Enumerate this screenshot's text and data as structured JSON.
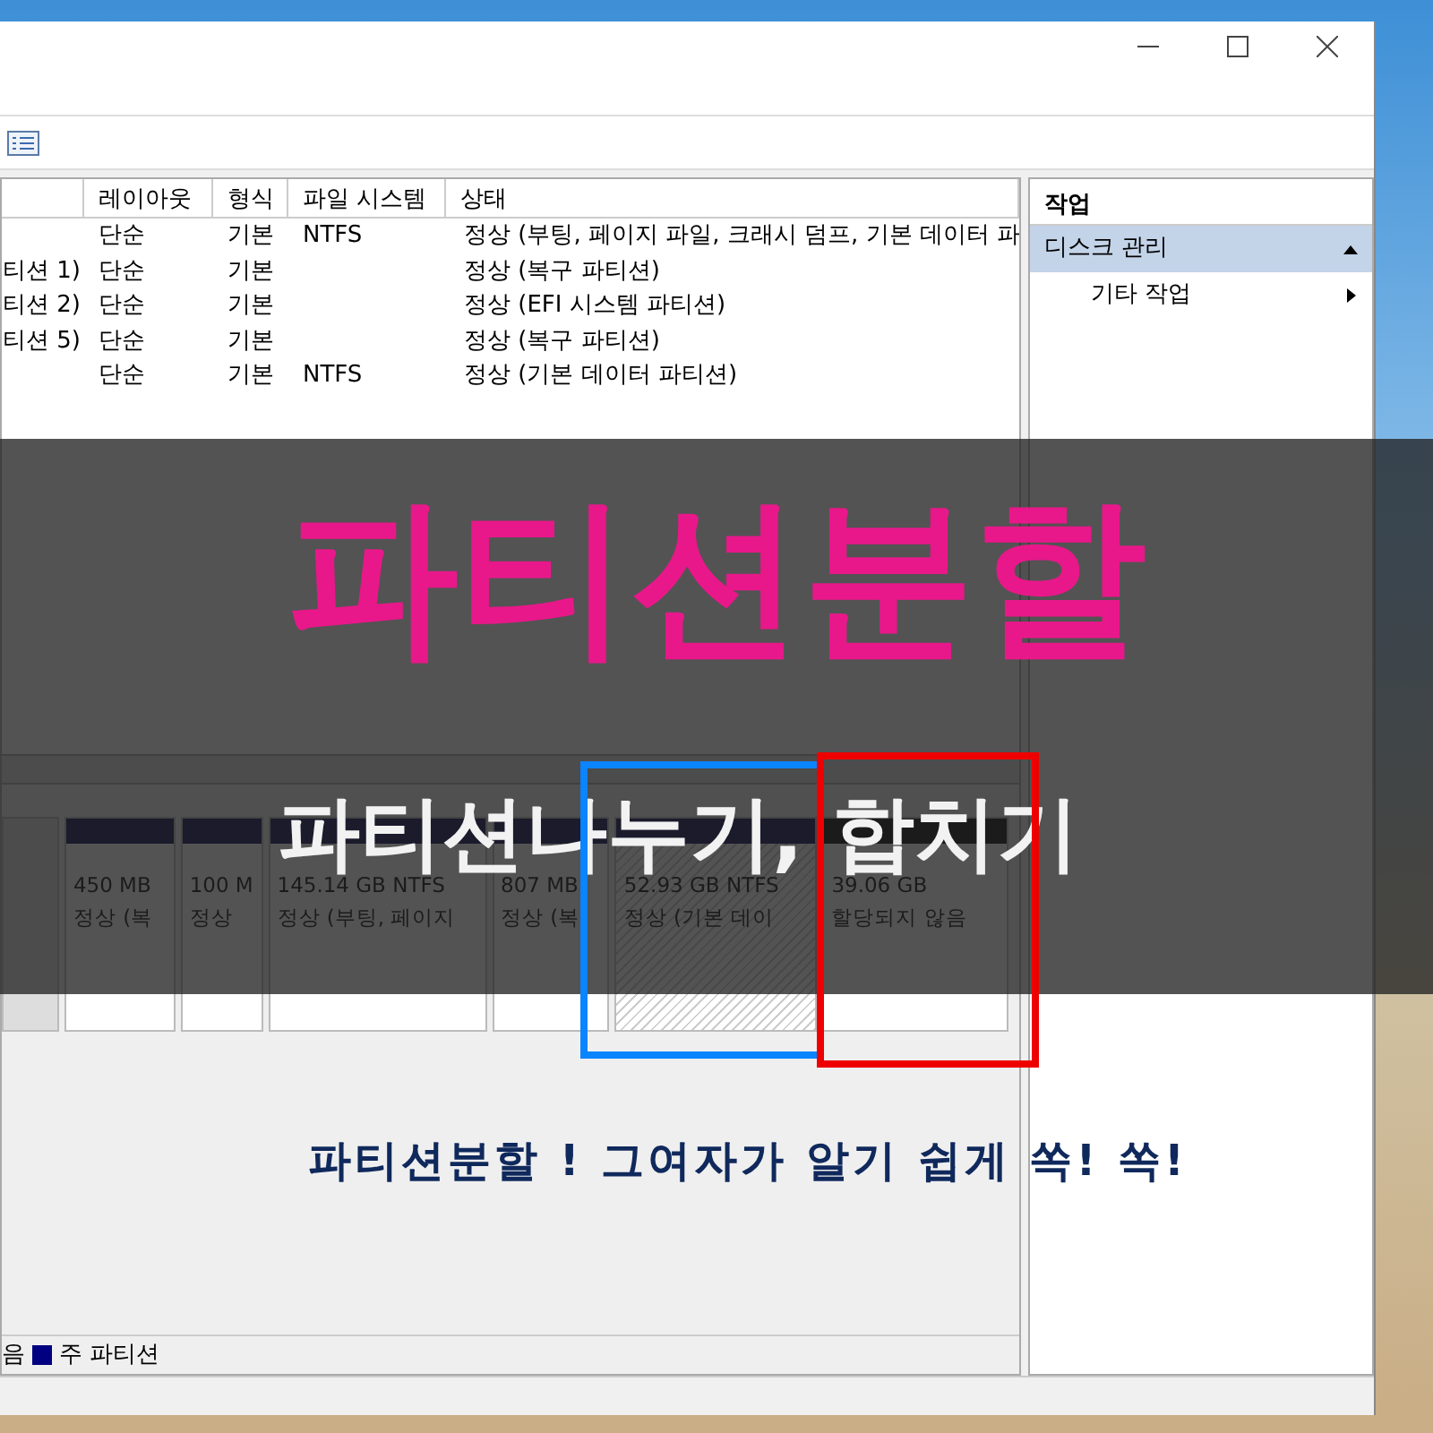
{
  "volume_list": {
    "columns": [
      "레이아웃",
      "형식",
      "파일 시스템",
      "상태"
    ],
    "rows": [
      {
        "layout": "단순",
        "type": "기본",
        "file_system": "NTFS",
        "status": "정상 (부팅, 페이지 파일, 크래시 덤프, 기본 데이터 파"
      },
      {
        "name": "티션 1)",
        "layout": "단순",
        "type": "기본",
        "status": "정상 (복구 파티션)"
      },
      {
        "name": "티션 2)",
        "layout": "단순",
        "type": "기본",
        "status": "정상 (EFI 시스템 파티션)"
      },
      {
        "name": "티션 5)",
        "layout": "단순",
        "type": "기본",
        "status": "정상 (복구 파티션)"
      },
      {
        "layout": "단순",
        "type": "기본",
        "file_system": "NTFS",
        "status": "정상 (기본 데이터 파티션)"
      }
    ]
  },
  "disk_map": {
    "partitions": [
      {
        "size": "450 MB",
        "status": "정상 (복",
        "kind": "primary",
        "selected": false
      },
      {
        "size": "100 M",
        "status": "정상",
        "kind": "primary",
        "selected": false
      },
      {
        "size": "145.14 GB NTFS",
        "status": "정상 (부팅, 페이지",
        "kind": "primary",
        "selected": false
      },
      {
        "size": "807 MB",
        "status": "정상 (복",
        "kind": "primary",
        "selected": false
      },
      {
        "size": "52.93 GB NTFS",
        "status": "정상 (기본 데이",
        "kind": "primary",
        "selected": true
      },
      {
        "size": "39.06 GB",
        "status": "할당되지 않음",
        "kind": "unallocated",
        "selected": false
      }
    ]
  },
  "legend": [
    {
      "label": "음"
    },
    {
      "label": "주 파티션",
      "color": "#000080"
    }
  ],
  "actions_pane": {
    "title": "작업",
    "items": [
      {
        "label": "디스크 관리",
        "kind": "header",
        "expanded": true
      },
      {
        "label": "기타 작업",
        "kind": "item"
      }
    ]
  },
  "overlay": {
    "title": "파티션분할",
    "subtitle": "파티션나누기, 합치기",
    "tagline": "파티션분할 ! 그여자가 알기 쉽게 쏙! 쏙!"
  }
}
